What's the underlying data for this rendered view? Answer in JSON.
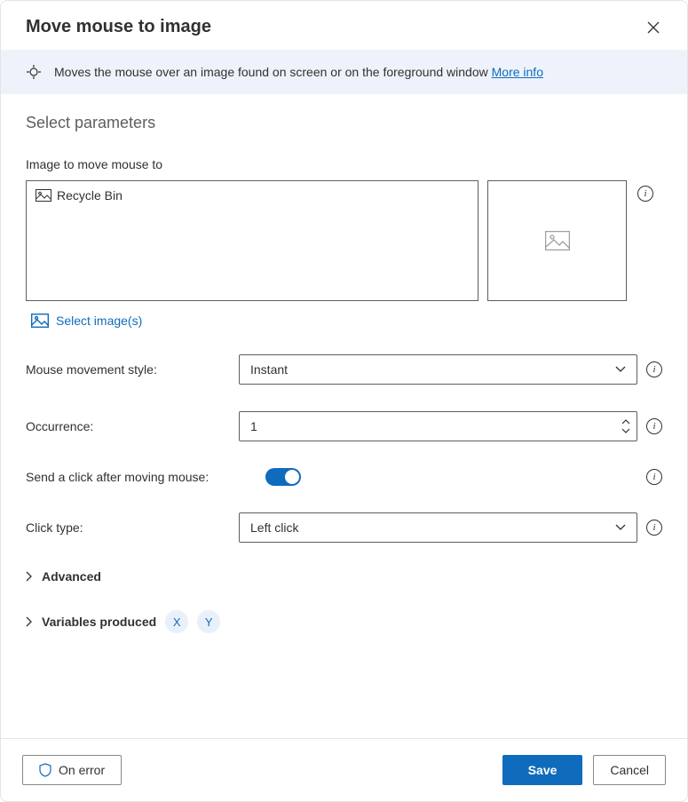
{
  "header": {
    "title": "Move mouse to image"
  },
  "banner": {
    "text": "Moves the mouse over an image found on screen or on the foreground window ",
    "link": "More info"
  },
  "section_heading": "Select parameters",
  "image_field": {
    "label": "Image to move mouse to",
    "item": "Recycle Bin",
    "select_link": "Select image(s)"
  },
  "movement_style": {
    "label": "Mouse movement style:",
    "value": "Instant"
  },
  "occurrence": {
    "label": "Occurrence:",
    "value": "1"
  },
  "send_click": {
    "label": "Send a click after moving mouse:"
  },
  "click_type": {
    "label": "Click type:",
    "value": "Left click"
  },
  "advanced_label": "Advanced",
  "variables": {
    "label": "Variables produced",
    "x": "X",
    "y": "Y"
  },
  "footer": {
    "on_error": "On error",
    "save": "Save",
    "cancel": "Cancel"
  }
}
